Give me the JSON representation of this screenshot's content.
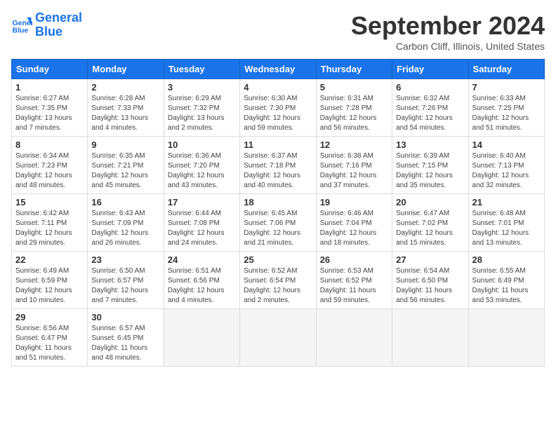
{
  "header": {
    "logo_line1": "General",
    "logo_line2": "Blue",
    "month_title": "September 2024",
    "subtitle": "Carbon Cliff, Illinois, United States"
  },
  "weekdays": [
    "Sunday",
    "Monday",
    "Tuesday",
    "Wednesday",
    "Thursday",
    "Friday",
    "Saturday"
  ],
  "weeks": [
    [
      {
        "day": "1",
        "info": "Sunrise: 6:27 AM\nSunset: 7:35 PM\nDaylight: 13 hours\nand 7 minutes."
      },
      {
        "day": "2",
        "info": "Sunrise: 6:28 AM\nSunset: 7:33 PM\nDaylight: 13 hours\nand 4 minutes."
      },
      {
        "day": "3",
        "info": "Sunrise: 6:29 AM\nSunset: 7:32 PM\nDaylight: 13 hours\nand 2 minutes."
      },
      {
        "day": "4",
        "info": "Sunrise: 6:30 AM\nSunset: 7:30 PM\nDaylight: 12 hours\nand 59 minutes."
      },
      {
        "day": "5",
        "info": "Sunrise: 6:31 AM\nSunset: 7:28 PM\nDaylight: 12 hours\nand 56 minutes."
      },
      {
        "day": "6",
        "info": "Sunrise: 6:32 AM\nSunset: 7:26 PM\nDaylight: 12 hours\nand 54 minutes."
      },
      {
        "day": "7",
        "info": "Sunrise: 6:33 AM\nSunset: 7:25 PM\nDaylight: 12 hours\nand 51 minutes."
      }
    ],
    [
      {
        "day": "8",
        "info": "Sunrise: 6:34 AM\nSunset: 7:23 PM\nDaylight: 12 hours\nand 48 minutes."
      },
      {
        "day": "9",
        "info": "Sunrise: 6:35 AM\nSunset: 7:21 PM\nDaylight: 12 hours\nand 45 minutes."
      },
      {
        "day": "10",
        "info": "Sunrise: 6:36 AM\nSunset: 7:20 PM\nDaylight: 12 hours\nand 43 minutes."
      },
      {
        "day": "11",
        "info": "Sunrise: 6:37 AM\nSunset: 7:18 PM\nDaylight: 12 hours\nand 40 minutes."
      },
      {
        "day": "12",
        "info": "Sunrise: 6:38 AM\nSunset: 7:16 PM\nDaylight: 12 hours\nand 37 minutes."
      },
      {
        "day": "13",
        "info": "Sunrise: 6:39 AM\nSunset: 7:15 PM\nDaylight: 12 hours\nand 35 minutes."
      },
      {
        "day": "14",
        "info": "Sunrise: 6:40 AM\nSunset: 7:13 PM\nDaylight: 12 hours\nand 32 minutes."
      }
    ],
    [
      {
        "day": "15",
        "info": "Sunrise: 6:42 AM\nSunset: 7:11 PM\nDaylight: 12 hours\nand 29 minutes."
      },
      {
        "day": "16",
        "info": "Sunrise: 6:43 AM\nSunset: 7:09 PM\nDaylight: 12 hours\nand 26 minutes."
      },
      {
        "day": "17",
        "info": "Sunrise: 6:44 AM\nSunset: 7:08 PM\nDaylight: 12 hours\nand 24 minutes."
      },
      {
        "day": "18",
        "info": "Sunrise: 6:45 AM\nSunset: 7:06 PM\nDaylight: 12 hours\nand 21 minutes."
      },
      {
        "day": "19",
        "info": "Sunrise: 6:46 AM\nSunset: 7:04 PM\nDaylight: 12 hours\nand 18 minutes."
      },
      {
        "day": "20",
        "info": "Sunrise: 6:47 AM\nSunset: 7:02 PM\nDaylight: 12 hours\nand 15 minutes."
      },
      {
        "day": "21",
        "info": "Sunrise: 6:48 AM\nSunset: 7:01 PM\nDaylight: 12 hours\nand 13 minutes."
      }
    ],
    [
      {
        "day": "22",
        "info": "Sunrise: 6:49 AM\nSunset: 6:59 PM\nDaylight: 12 hours\nand 10 minutes."
      },
      {
        "day": "23",
        "info": "Sunrise: 6:50 AM\nSunset: 6:57 PM\nDaylight: 12 hours\nand 7 minutes."
      },
      {
        "day": "24",
        "info": "Sunrise: 6:51 AM\nSunset: 6:56 PM\nDaylight: 12 hours\nand 4 minutes."
      },
      {
        "day": "25",
        "info": "Sunrise: 6:52 AM\nSunset: 6:54 PM\nDaylight: 12 hours\nand 2 minutes."
      },
      {
        "day": "26",
        "info": "Sunrise: 6:53 AM\nSunset: 6:52 PM\nDaylight: 11 hours\nand 59 minutes."
      },
      {
        "day": "27",
        "info": "Sunrise: 6:54 AM\nSunset: 6:50 PM\nDaylight: 11 hours\nand 56 minutes."
      },
      {
        "day": "28",
        "info": "Sunrise: 6:55 AM\nSunset: 6:49 PM\nDaylight: 11 hours\nand 53 minutes."
      }
    ],
    [
      {
        "day": "29",
        "info": "Sunrise: 6:56 AM\nSunset: 6:47 PM\nDaylight: 11 hours\nand 51 minutes."
      },
      {
        "day": "30",
        "info": "Sunrise: 6:57 AM\nSunset: 6:45 PM\nDaylight: 11 hours\nand 48 minutes."
      },
      {
        "day": "",
        "info": ""
      },
      {
        "day": "",
        "info": ""
      },
      {
        "day": "",
        "info": ""
      },
      {
        "day": "",
        "info": ""
      },
      {
        "day": "",
        "info": ""
      }
    ]
  ]
}
